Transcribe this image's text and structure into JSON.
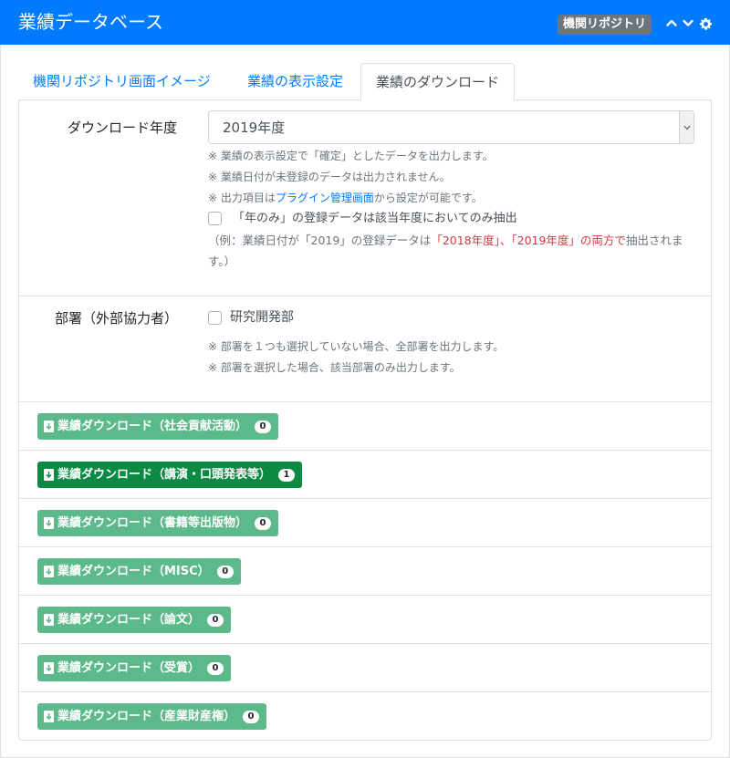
{
  "header": {
    "title": "業績データベース",
    "repository_badge": "機関リポジトリ",
    "icons": [
      "chevron-up-icon",
      "chevron-down-icon",
      "gear-icon"
    ]
  },
  "tabs": [
    {
      "label": "機関リポジトリ画面イメージ",
      "active": false
    },
    {
      "label": "業績の表示設定",
      "active": false
    },
    {
      "label": "業績のダウンロード",
      "active": true
    }
  ],
  "download_year": {
    "label": "ダウンロード年度",
    "selected": "2019年度",
    "notes": [
      "※ 業績の表示設定で「確定」としたデータを出力します。",
      "※ 業績日付が未登録のデータは出力されません。"
    ],
    "plugin_note": {
      "prefix": "※ 出力項目は",
      "link": "プラグイン管理画面",
      "suffix": "から設定が可能です。"
    },
    "year_only_checkbox": {
      "label": "「年のみ」の登録データは該当年度においてのみ抽出",
      "checked": false
    },
    "example": {
      "prefix": "（例：業績日付が「2019」の登録データは",
      "red": "「2018年度」、「2019年度」の両方で",
      "suffix": "抽出されま",
      "line2": "す。）"
    }
  },
  "department": {
    "label": "部署（外部協力者）",
    "checkbox": {
      "label": "研究開発部",
      "checked": false
    },
    "notes": [
      "※ 部署を１つも選択していない場合、全部署を出力します。",
      "※ 部署を選択した場合、該当部署のみ出力します。"
    ]
  },
  "download_buttons": [
    {
      "label": "業績ダウンロード（社会貢献活動）",
      "count": "0"
    },
    {
      "label": "業績ダウンロード（講演・口頭発表等）",
      "count": "1"
    },
    {
      "label": "業績ダウンロード（書籍等出版物）",
      "count": "0"
    },
    {
      "label": "業績ダウンロード（MISC）",
      "count": "0"
    },
    {
      "label": "業績ダウンロード（論文）",
      "count": "0"
    },
    {
      "label": "業績ダウンロード（受賞）",
      "count": "0"
    },
    {
      "label": "業績ダウンロード（産業財産権）",
      "count": "0"
    }
  ],
  "colors": {
    "header": "#007bff",
    "button": "#5cb98a",
    "button_active": "#0b8a43",
    "link": "#007bff",
    "highlight": "#dc3545"
  }
}
